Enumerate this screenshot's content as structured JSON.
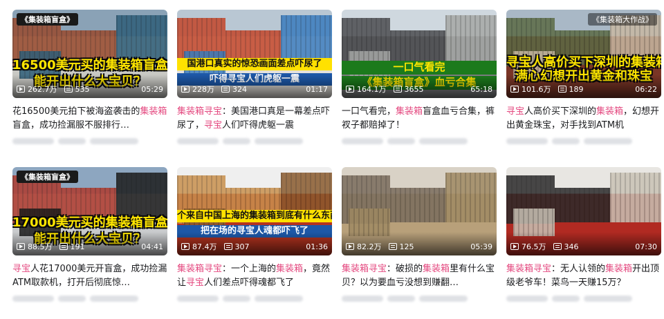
{
  "videos": [
    {
      "tag": "《集装箱盲盒》",
      "captions": [
        "16500美元买的集装箱盲盒",
        "能开出什么大宝贝？"
      ],
      "views": "262.7万",
      "danmaku": "535",
      "duration": "05:29",
      "title_parts": [
        [
          "花16500美元拍下被海盗袭击的",
          false
        ],
        [
          "集装箱",
          true
        ],
        [
          "盲盒，成功捡漏服不服排行…",
          false
        ]
      ],
      "scene": [
        "#8aa2b6",
        "#c9c9c4",
        "#9a4b2e",
        "#2f5f7a"
      ]
    },
    {
      "tag": "",
      "captions": [
        "国港口真实的惊恐画面差点吓尿了",
        "吓得寻宝人们虎躯一震"
      ],
      "views": "228万",
      "danmaku": "324",
      "duration": "01:17",
      "title_parts": [
        [
          "集装箱寻宝",
          true
        ],
        [
          "：美国港口真是一幕差点吓尿了，",
          false
        ],
        [
          "寻宝",
          true
        ],
        [
          "人们吓得虎躯一震",
          false
        ]
      ],
      "scene": [
        "#b9c7d3",
        "#e4e1dc",
        "#c4462b",
        "#3b7dbf"
      ]
    },
    {
      "tag": "",
      "captions": [
        "一口气看完",
        "《集装箱盲盒》血亏合集"
      ],
      "views": "164.1万",
      "danmaku": "3655",
      "duration": "65:18",
      "title_parts": [
        [
          "一口气看完，",
          false
        ],
        [
          "集装箱",
          true
        ],
        [
          "盲盒血亏合集，裤衩子都赔掉了！",
          false
        ]
      ],
      "scene": [
        "#cfd8df",
        "#7c7e80",
        "#4c4d50",
        "#a6a8a6"
      ]
    },
    {
      "tag": "《集装箱大作战》",
      "captions": [
        "寻宝人高价买下深圳的集装箱",
        "满心幻想开出黄金和珠宝"
      ],
      "views": "101.6万",
      "danmaku": "189",
      "duration": "06:22",
      "title_parts": [
        [
          "寻宝",
          true
        ],
        [
          "人高价买下深圳的",
          false
        ],
        [
          "集装箱",
          true
        ],
        [
          "，幻想开出黄金珠宝，对手找到ATM机",
          false
        ]
      ],
      "scene": [
        "#a9b8c6",
        "#7a3526",
        "#5c6b45",
        "#c8b9a3"
      ]
    },
    {
      "tag": "《集装箱盲盒》",
      "captions": [
        "17000美元买的集装箱盲盒",
        "能开出什么大宝贝？"
      ],
      "views": "88.5万",
      "danmaku": "191",
      "duration": "04:41",
      "title_parts": [
        [
          "寻宝",
          true
        ],
        [
          "人花17000美元开盲盒，成功捡漏ATM取款机，打开后彻底惊…",
          false
        ]
      ],
      "scene": [
        "#8da6c0",
        "#c9cbcd",
        "#b03a2e",
        "#1d1d1d"
      ]
    },
    {
      "tag": "",
      "captions": [
        "个来自中国上海的集装箱到底有什么东西",
        "把在场的寻宝人魂都吓飞了"
      ],
      "views": "87.4万",
      "danmaku": "307",
      "duration": "01:36",
      "title_parts": [
        [
          "集装箱寻宝",
          true
        ],
        [
          "：一个上海的",
          false
        ],
        [
          "集装箱",
          true
        ],
        [
          "，竟然让",
          false
        ],
        [
          "寻宝",
          true
        ],
        [
          "人们差点吓得魂都飞了",
          false
        ]
      ],
      "scene": [
        "#efefef",
        "#b5331f",
        "#c9904e",
        "#8a5a2e"
      ]
    },
    {
      "tag": "",
      "captions": [],
      "views": "82.2万",
      "danmaku": "125",
      "duration": "05:39",
      "title_parts": [
        [
          "集装箱寻宝",
          true
        ],
        [
          "：破损的",
          false
        ],
        [
          "集装箱",
          true
        ],
        [
          "里有什么宝贝？以为要血亏没想到赚翻…",
          false
        ]
      ],
      "scene": [
        "#d9d2c6",
        "#b8a07a",
        "#7a6d5d",
        "#a08a63"
      ]
    },
    {
      "tag": "",
      "captions": [],
      "views": "76.5万",
      "danmaku": "346",
      "duration": "07:30",
      "title_parts": [
        [
          "集装箱寻宝",
          true
        ],
        [
          "：无人认领的",
          false
        ],
        [
          "集装箱",
          true
        ],
        [
          "开出顶级老爷车！菜鸟一天赚15万？",
          false
        ]
      ],
      "scene": [
        "#e8e6e2",
        "#b12a22",
        "#2b2b2b",
        "#c9c2b5"
      ]
    }
  ]
}
